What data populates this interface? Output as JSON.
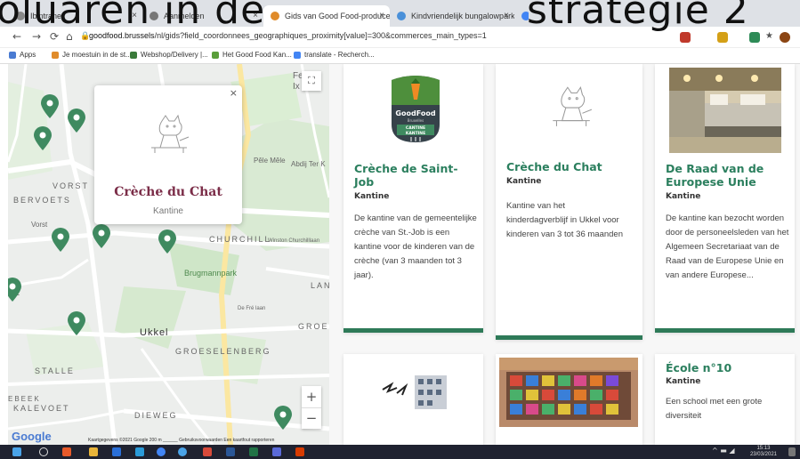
{
  "caption": {
    "left": "oluaren in de",
    "right": "strategie 2"
  },
  "browser": {
    "tabs": [
      "Ibintranet",
      "Aanmelden",
      "Gids van Good Food-producent",
      "Kindvriendelijk bungalowpark in",
      "Google zoeken"
    ],
    "url_host": "goodfood.brussels",
    "url_path": "/nl/gids?field_coordonnees_geographiques_proximity[value]=300&commerces_main_types=1",
    "bookmarks": [
      "Apps",
      "Je moestuin in de st...",
      "Webshop/Delivery |...",
      "Het Good Food Kan...",
      "translate - Recherch..."
    ]
  },
  "map": {
    "labels": [
      "VORST",
      "BERVOETS",
      "CHURCHILL",
      "Brugmannpark",
      "Ukkel",
      "GROESELENBERG",
      "STALLE",
      "DIEWEG",
      "KALEVOET",
      "EBEEK",
      "GROEN",
      "LAN",
      "Abdij Ter K",
      "Pêle Mêle",
      "Vorst",
      "Winston Churchilllaan",
      "De Fré laan",
      "Fe",
      "Ix",
      "LE"
    ],
    "popup": {
      "title": "Crèche du Chat",
      "subtitle": "Kantine"
    },
    "zoom_in": "+",
    "zoom_out": "−",
    "close": "×",
    "google": "Google",
    "footer": "Kaartgegevens ©2021 Google   200 m ______   Gebruiksvoorwaarden   Een kaartfout rapporteren"
  },
  "cards": [
    {
      "title": "Crèche de Saint-Job",
      "type": "Kantine",
      "desc": "De kantine van de gemeentelijke crèche van St.-Job is een kantine voor de kinderen van de crèche (van 3 maanden tot 3 jaar).",
      "logo": {
        "line1": "GoodFood",
        "line2": "Bruxelles",
        "line3": "CANTINE",
        "line4": "KANTINE"
      }
    },
    {
      "title": "Crèche du Chat",
      "type": "Kantine",
      "desc": "Kantine van het kinderdagverblijf in Ukkel voor kinderen van 3 tot 36 maanden"
    },
    {
      "title": "De Raad van de Europese Unie",
      "type": "Kantine",
      "desc": "De kantine kan bezocht worden door de personeelsleden van het Algemeen Secretariaat van de Raad van de Europese Unie en van andere Europese..."
    },
    {
      "title": "École n°10",
      "type": "Kantine",
      "desc": "Een school met een grote diversiteit"
    }
  ],
  "taskbar": {
    "time": "15:13",
    "date": "23/03/2021"
  },
  "colors": {
    "accent": "#2b7f5e",
    "popup_title": "#7b2d48",
    "pin": "#3f8a60"
  }
}
